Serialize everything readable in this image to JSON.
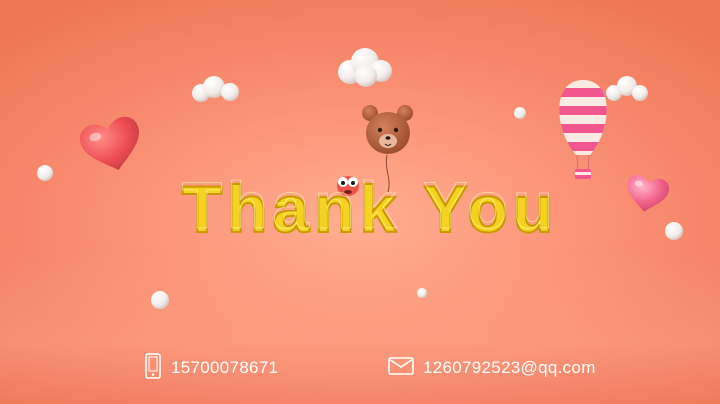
{
  "title": "Thank You",
  "contacts": {
    "phone": {
      "icon": "phone-icon",
      "value": "15700078671"
    },
    "email": {
      "icon": "envelope-icon",
      "value": "1260792523@qq.com"
    }
  },
  "colors": {
    "background": "#f7876a",
    "letters": "#f5d21f",
    "letter_outline": "#c99a00",
    "heart": "#f0565f",
    "balloon_pink": "#f2568f",
    "bear": "#b55d3c",
    "text": "#ffffff"
  }
}
